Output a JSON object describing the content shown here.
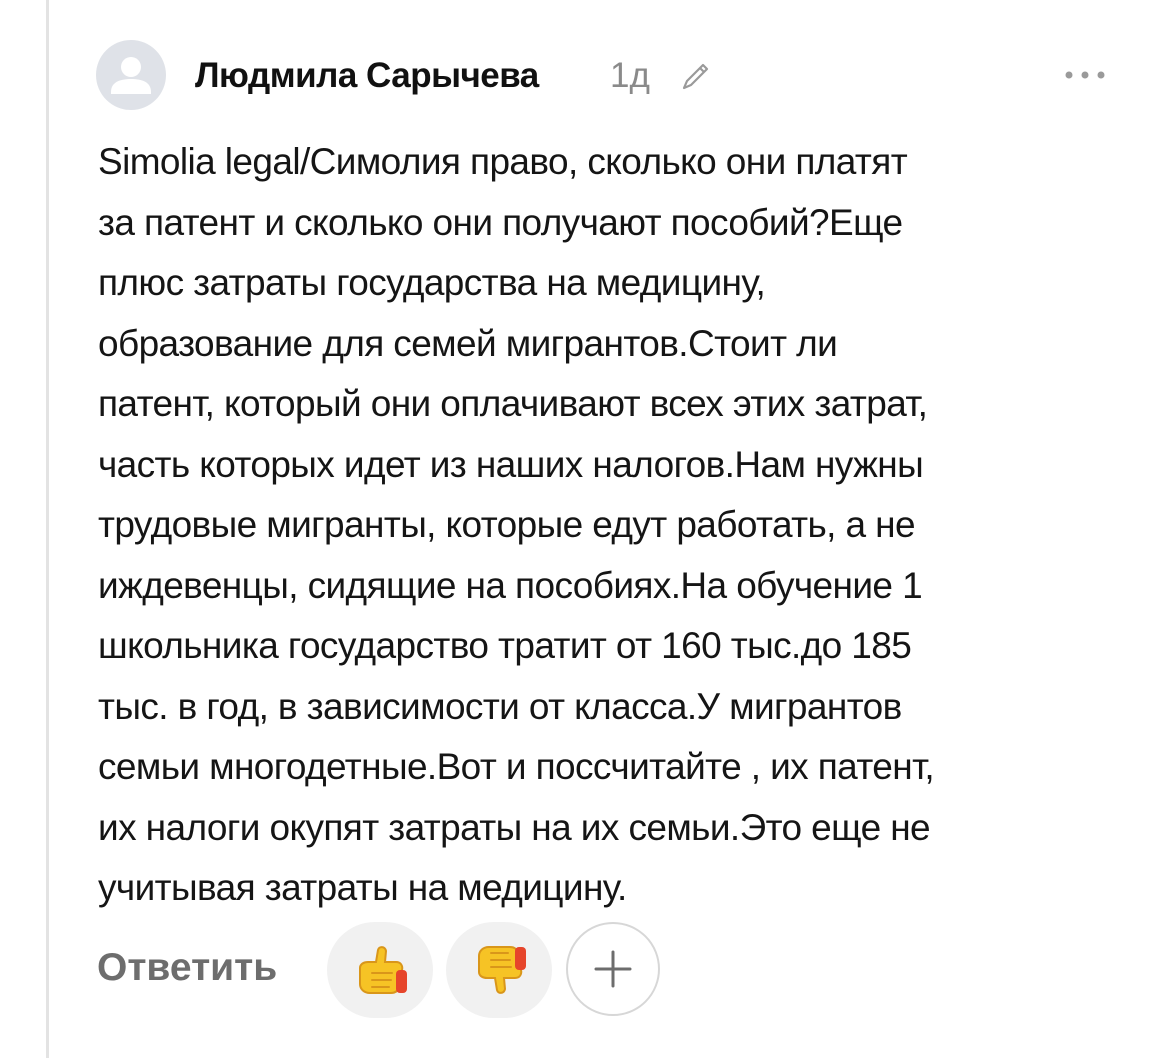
{
  "comment": {
    "author": "Людмила Сарычева",
    "time": "1д",
    "text": "Simolia legal/Симолия право, сколько они платят\nза патент и  сколько они получают пособий?Еще\nплюс затраты государства на медицину,\nобразование для семей мигрантов.Стоит ли\nпатент, который они оплачивают всех этих затрат,\nчасть которых идет из наших налогов.Нам нужны\nтрудовые мигранты, которые едут работать, а не\nиждевенцы, сидящие на пособиях.На обучение 1\nшкольника государство тратит от 160 тыс.до 185\nтыс. в год, в зависимости от класса.У мигрантов\nсемьи многодетные.Вот и поссчитайте , их патент,\nих налоги окупят затраты на их семьи.Это еще не\nучитывая затраты на медицину."
  },
  "actions": {
    "reply_label": "Ответить",
    "like_icon": "thumbs-up-icon",
    "dislike_icon": "thumbs-down-icon",
    "add_icon": "plus-icon",
    "more_icon": "more-dots-icon",
    "edit_icon": "pencil-icon"
  },
  "colors": {
    "author": "#111111",
    "muted": "#8a8a8a",
    "reply": "#6d6d6d",
    "reaction_bg": "#f1f1f1",
    "avatar_bg": "#dfe2e8",
    "emoji_yellow": "#f6c325",
    "emoji_red": "#e6452b"
  }
}
